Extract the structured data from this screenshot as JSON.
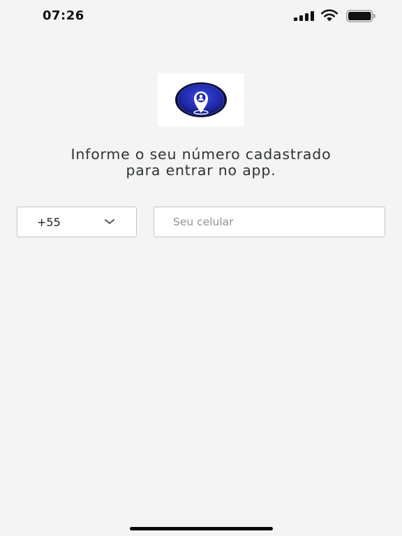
{
  "status_bar": {
    "time": "07:26",
    "signal_icon": "signal-bars-icon",
    "wifi_icon": "wifi-icon",
    "battery_icon": "battery-full-icon"
  },
  "logo": {
    "icon": "location-pin-user-icon",
    "colors": {
      "ring": "#0b0f3a",
      "fill": "#2a35c9",
      "pin": "#ffffff"
    }
  },
  "instruction": {
    "line1": "Informe o seu número cadastrado",
    "line2": "para entrar no app."
  },
  "country_select": {
    "value": "+55",
    "icon": "chevron-down-icon"
  },
  "phone_field": {
    "value": "",
    "placeholder": "Seu celular"
  }
}
